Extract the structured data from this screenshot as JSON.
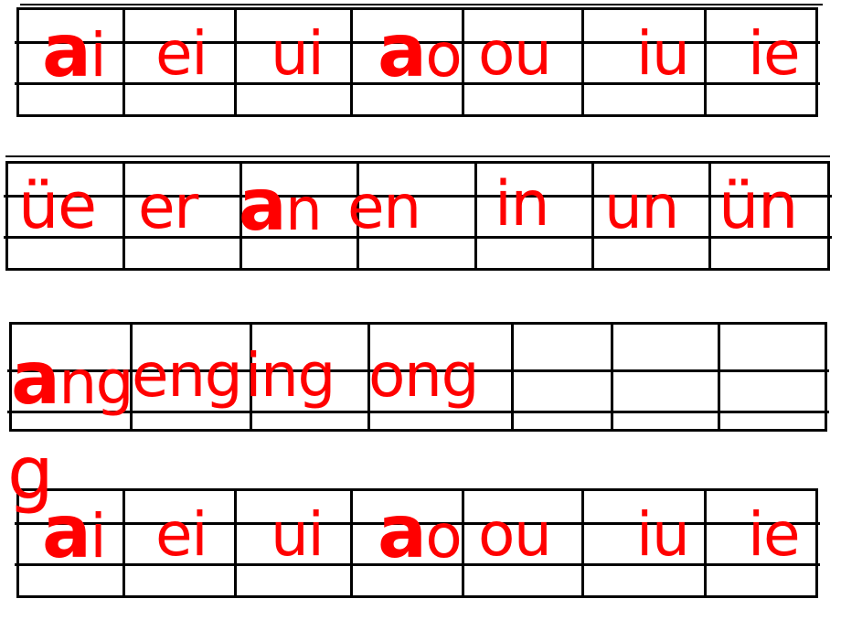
{
  "document": {
    "title": "Pinyin Finals Practice Worksheet",
    "ink_color": "#FF0000",
    "line_color": "#000000",
    "background_color": "#FFFFFF"
  },
  "blocks": [
    {
      "id": "block-1",
      "columns": 7,
      "syllables": [
        "ai",
        "ei",
        "ui",
        "ao",
        "ou",
        "iu",
        "ie"
      ]
    },
    {
      "id": "block-2",
      "columns": 7,
      "syllables": [
        "üe",
        "er",
        "an",
        "en",
        "in",
        "un",
        "ün"
      ]
    },
    {
      "id": "block-3",
      "columns": 7,
      "syllables": [
        "ang",
        "eng",
        "ing",
        "ong",
        "",
        "",
        ""
      ]
    },
    {
      "id": "block-4",
      "columns": 7,
      "syllables": [
        "ai",
        "ei",
        "ui",
        "ao",
        "ou",
        "iu",
        "ie"
      ]
    }
  ],
  "artifacts": {
    "stray_glyph": "g"
  }
}
